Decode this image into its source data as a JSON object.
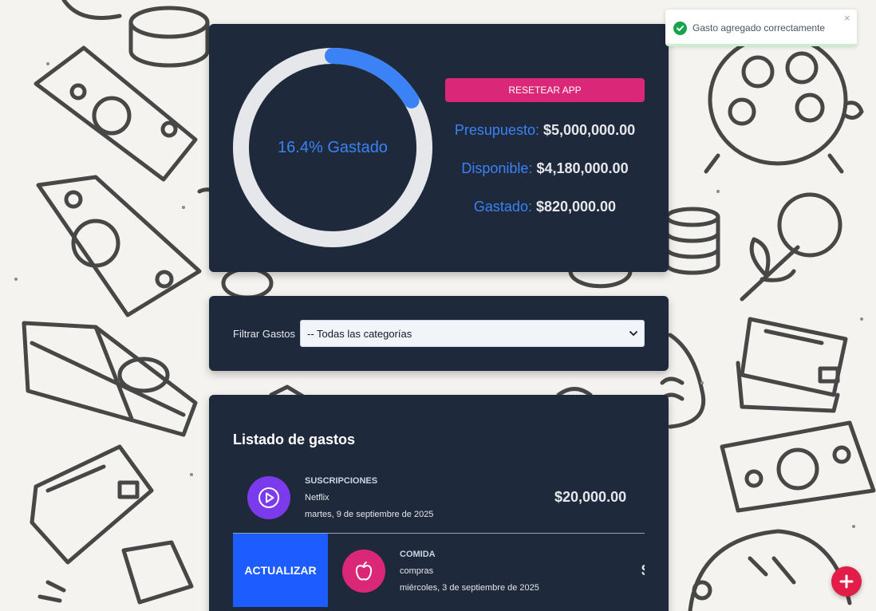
{
  "colors": {
    "panel": "#1e293b",
    "accent_blue": "#3b82f6",
    "reset_pink": "#db2777",
    "update_blue": "#1d5cff",
    "fab_red": "#e11d48",
    "success_green": "#16a34a"
  },
  "budget": {
    "percent_spent": 16.4,
    "progress_label": "16.4% Gastado",
    "reset_label": "RESETEAR APP",
    "budget_label": "Presupuesto:",
    "budget_value": "$5,000,000.00",
    "available_label": "Disponible:",
    "available_value": "$4,180,000.00",
    "spent_label": "Gastado:",
    "spent_value": "$820,000.00"
  },
  "filter": {
    "label": "Filtrar Gastos",
    "selected": "-- Todas las categorías"
  },
  "expenses": {
    "title": "Listado de gastos",
    "items": [
      {
        "category": "SUSCRIPCIONES",
        "name": "Netflix",
        "date": "martes, 9 de septiembre de 2025",
        "amount": "$20,000.00",
        "icon": "play-icon",
        "icon_color": "#7c3aed"
      },
      {
        "category": "COMIDA",
        "name": "compras",
        "date": "miércoles, 3 de septiembre de 2025",
        "amount": "$",
        "icon": "apple-icon",
        "icon_color": "#db2777",
        "swipe_action": "ACTUALIZAR"
      }
    ]
  },
  "toast": {
    "message": "Gasto agregado correctamente",
    "close": "×",
    "icon": "check-icon"
  },
  "fab": {
    "icon": "plus-icon"
  }
}
